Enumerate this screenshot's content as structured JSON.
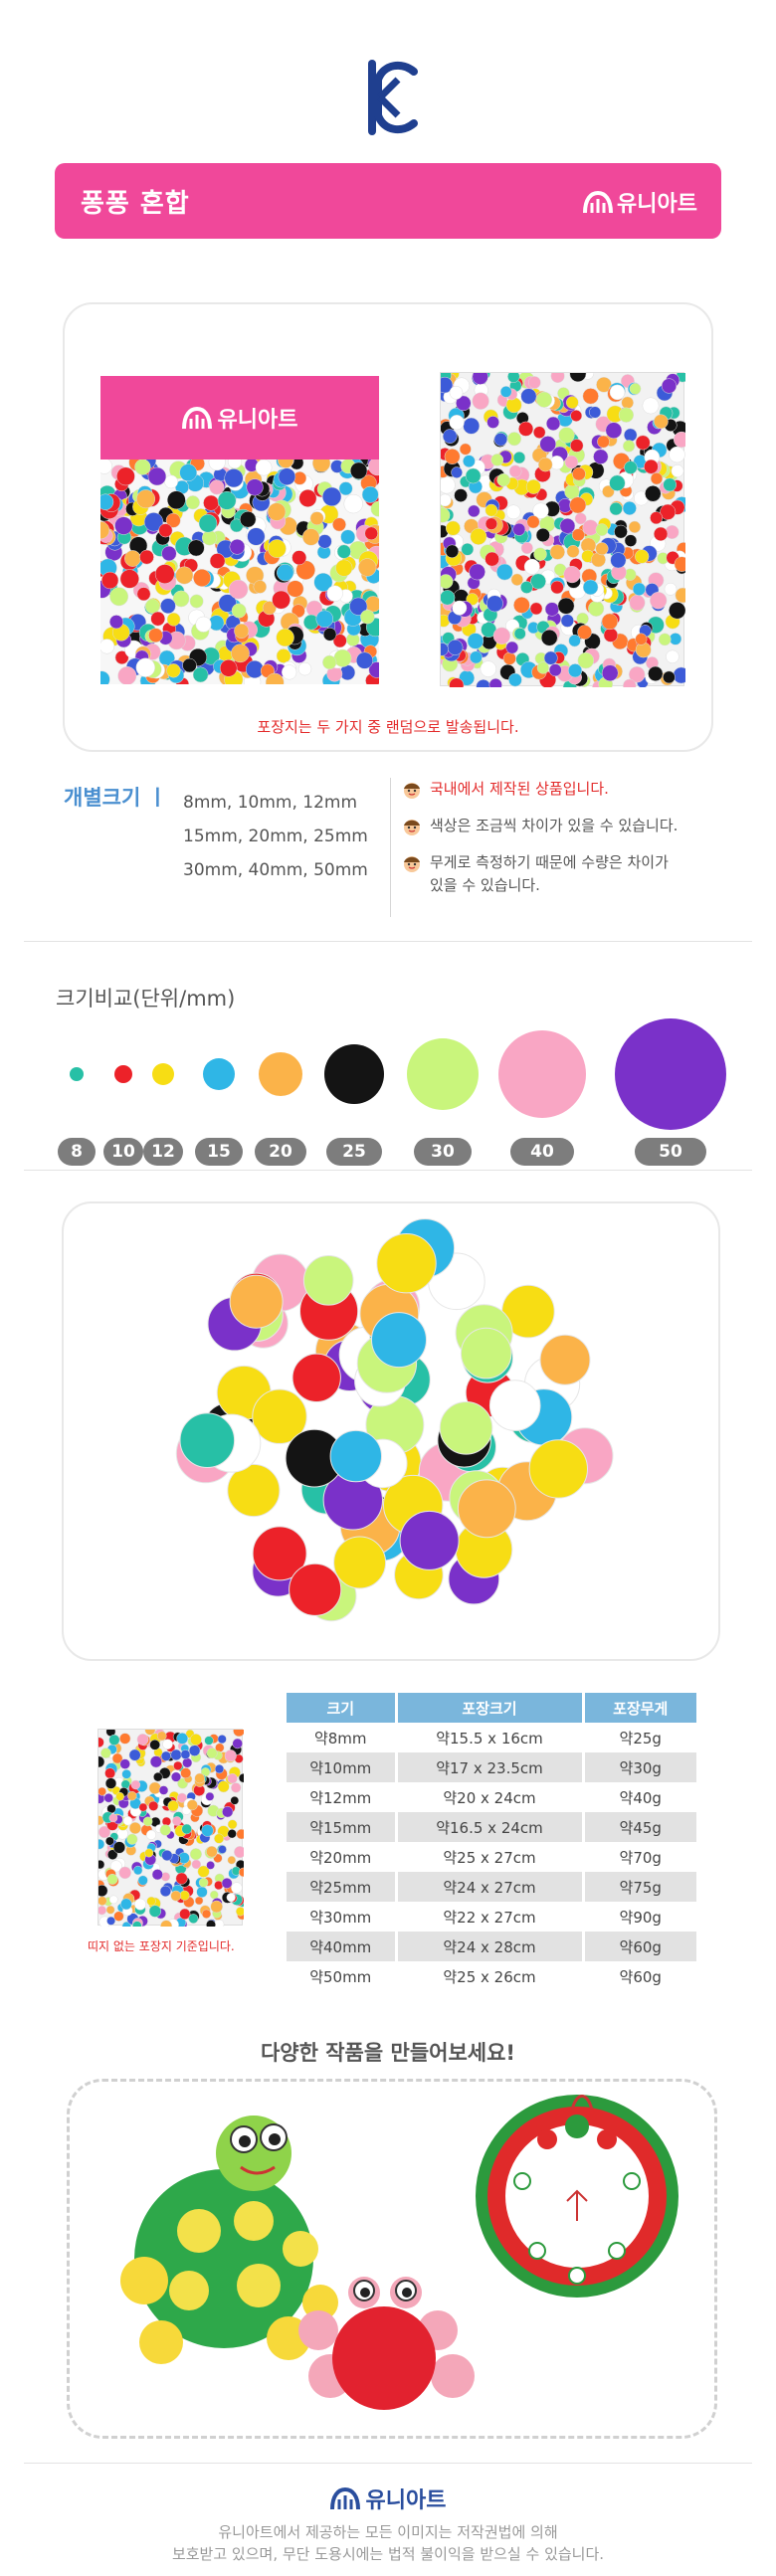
{
  "header": {
    "product_title": "퐁퐁 혼합",
    "brand": "유니아트"
  },
  "package": {
    "label_brand": "유니아트",
    "note": "포장지는 두 가지 중 랜덤으로 발송됩니다."
  },
  "sizes": {
    "label": "개별크기 ㅣ",
    "lines": [
      "8mm, 10mm, 12mm",
      "15mm, 20mm, 25mm",
      "30mm, 40mm, 50mm"
    ]
  },
  "notes": [
    {
      "text": "국내에서 제작된 상품입니다.",
      "highlight": true
    },
    {
      "text": "색상은 조금씩 차이가 있을 수 있습니다.",
      "highlight": false
    },
    {
      "text": "무게로 측정하기 때문에 수량은 차이가\n있을 수 있습니다.",
      "highlight": false
    }
  ],
  "compare": {
    "title": "크기비교(단위/mm)",
    "labels": [
      "8",
      "10",
      "12",
      "15",
      "20",
      "25",
      "30",
      "40",
      "50"
    ],
    "colors": [
      "#27c0a6",
      "#ec2229",
      "#f7dd14",
      "#2fb6e6",
      "#fbb349",
      "#141414",
      "#c9f57c",
      "#f9a6c4",
      "#7a31c9"
    ]
  },
  "spec": {
    "headers": [
      "크기",
      "포장크기",
      "포장무게"
    ],
    "rows": [
      [
        "약8mm",
        "약15.5 x 16cm",
        "약25g"
      ],
      [
        "약10mm",
        "약17 x 23.5cm",
        "약30g"
      ],
      [
        "약12mm",
        "약20 x 24cm",
        "약40g"
      ],
      [
        "약15mm",
        "약16.5 x 24cm",
        "약45g"
      ],
      [
        "약20mm",
        "약25 x 27cm",
        "약70g"
      ],
      [
        "약25mm",
        "약24 x 27cm",
        "약75g"
      ],
      [
        "약30mm",
        "약22 x 27cm",
        "약90g"
      ],
      [
        "약40mm",
        "약24 x 28cm",
        "약60g"
      ],
      [
        "약50mm",
        "약25 x 26cm",
        "약60g"
      ]
    ],
    "thumb_note": "띠지 없는 포장지 기준입니다."
  },
  "crafts": {
    "title": "다양한 작품을 만들어보세요!"
  },
  "footer": {
    "brand": "유니아트",
    "copyright": "유니아트에서 제공하는 모든 이미지는 저작권법에 의해\n보호받고 있으며, 무단 도용시에는 법적 불이익을 받으실 수 있습니다."
  },
  "colors": {
    "accent_pink": "#f0489a",
    "size_blue": "#4a8fd0",
    "table_header": "#7ab6dc",
    "notice_red": "#e32a2a",
    "brand_navy": "#2a4e9e"
  },
  "icons": [
    "kc-mark-icon",
    "unart-logo-icon",
    "smiley-face-icon"
  ]
}
